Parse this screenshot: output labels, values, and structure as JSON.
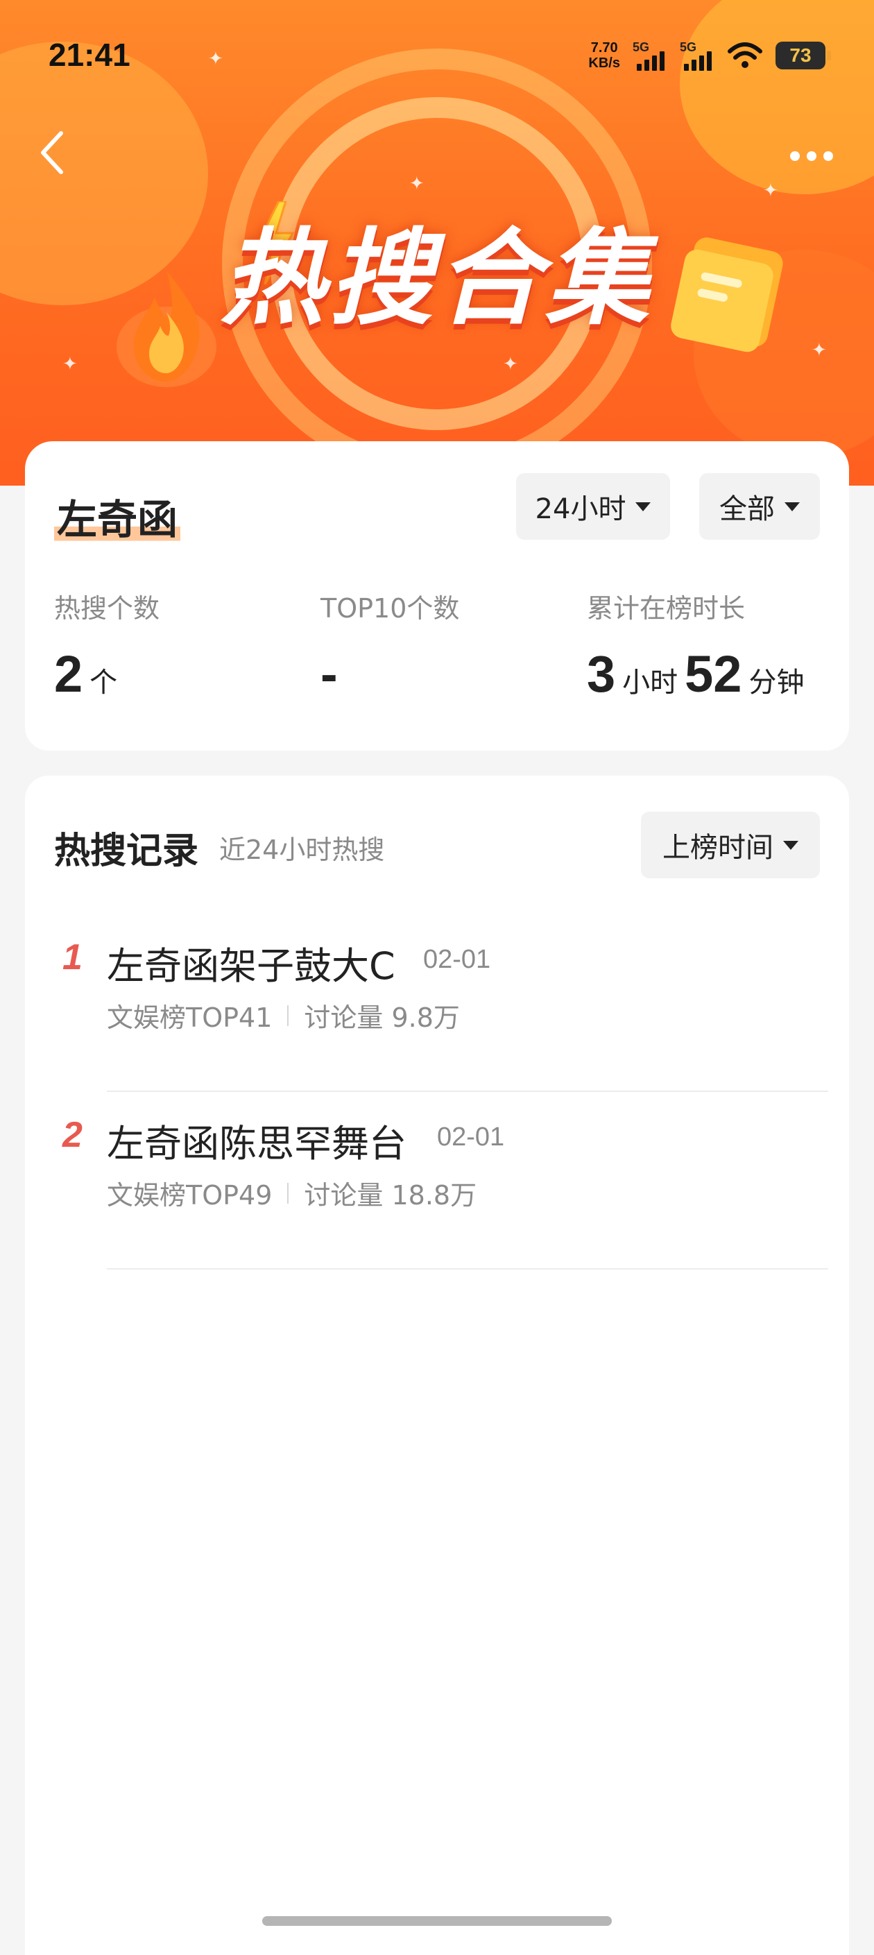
{
  "status_bar": {
    "time": "21:41",
    "net_speed_value": "7.70",
    "net_speed_unit": "KB/s",
    "signal_1_label": "5G",
    "signal_2_label": "5G",
    "battery": "73",
    "icons": [
      "signal-icon",
      "signal-icon",
      "wifi-icon",
      "battery-icon"
    ]
  },
  "header": {
    "back_icon": "chevron-left-icon",
    "more_icon": "more-dots-icon",
    "banner_title": "热搜合集",
    "banner_colors": {
      "primary": "#ff6d22",
      "accent": "#ffc94a"
    }
  },
  "summary": {
    "name": "左奇函",
    "time_filter": "24小时",
    "scope_filter": "全部",
    "stats": [
      {
        "label": "热搜个数",
        "value": "2",
        "unit": "个"
      },
      {
        "label": "TOP10个数",
        "value": "-"
      },
      {
        "label": "累计在榜时长",
        "hours": "3",
        "hours_unit": "小时",
        "minutes": "52",
        "minutes_unit": "分钟"
      }
    ]
  },
  "records": {
    "title": "热搜记录",
    "subtitle": "近24小时热搜",
    "sort_filter": "上榜时间",
    "items": [
      {
        "rank": "1",
        "title": "左奇函架子鼓大C",
        "date": "02-01",
        "board": "文娱榜TOP41",
        "discussion": "讨论量 9.8万"
      },
      {
        "rank": "2",
        "title": "左奇函陈思罕舞台",
        "date": "02-01",
        "board": "文娱榜TOP49",
        "discussion": "讨论量 18.8万"
      }
    ],
    "rank_color": "#e85a50"
  }
}
